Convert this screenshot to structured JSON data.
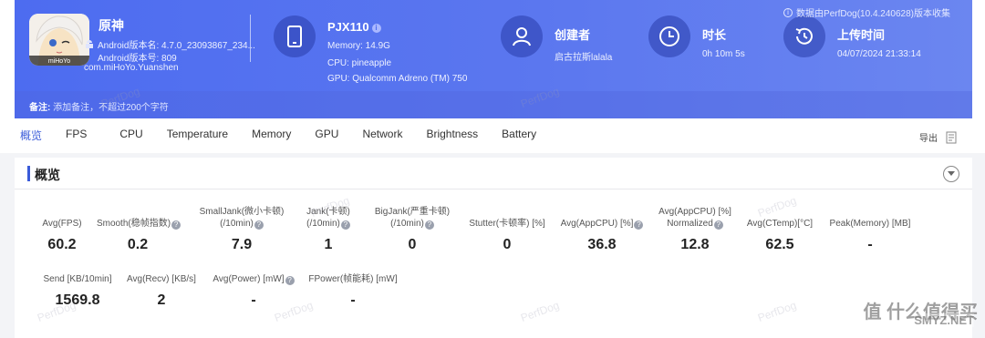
{
  "header": {
    "app_name": "原神",
    "android_version": "Android版本名: 4.7.0_23093867_234...",
    "android_code": "Android版本号: 809",
    "package": "com.miHoYo.Yuanshen",
    "app_icon_text": "miHoYo",
    "device": {
      "model": "PJX110",
      "memory": "Memory: 14.9G",
      "cpu": "CPU: pineapple",
      "gpu": "GPU: Qualcomm Adreno (TM) 750"
    },
    "creator": {
      "title": "创建者",
      "value": "启古拉斯lalala"
    },
    "duration": {
      "title": "时长",
      "value": "0h 10m 5s"
    },
    "upload": {
      "title": "上传时间",
      "value": "04/07/2024 21:33:14"
    },
    "data_source": "数据由PerfDog(10.4.240628)版本收集",
    "note_label": "备注:",
    "note_placeholder": "添加备注，不超过200个字符"
  },
  "tabs": [
    "概览",
    "FPS",
    "CPU",
    "Temperature",
    "Memory",
    "GPU",
    "Network",
    "Brightness",
    "Battery"
  ],
  "active_tab": "概览",
  "export_label": "导出",
  "section_title": "概览",
  "metrics_row1": [
    {
      "label1": "",
      "label2": "Avg(FPS)",
      "help": false,
      "value": "60.2"
    },
    {
      "label1": "",
      "label2": "Smooth(稳帧指数)",
      "help": true,
      "value": "0.2"
    },
    {
      "label1": "SmallJank(微小卡顿)",
      "label2": "(/10min)",
      "help": true,
      "value": "7.9"
    },
    {
      "label1": "Jank(卡顿)",
      "label2": "(/10min)",
      "help": true,
      "value": "1"
    },
    {
      "label1": "BigJank(严重卡顿)",
      "label2": "(/10min)",
      "help": true,
      "value": "0"
    },
    {
      "label1": "",
      "label2": "Stutter(卡顿率) [%]",
      "help": false,
      "value": "0"
    },
    {
      "label1": "",
      "label2": "Avg(AppCPU) [%]",
      "help": true,
      "value": "36.8"
    },
    {
      "label1": "Avg(AppCPU) [%]",
      "label2": "Normalized",
      "help": true,
      "value": "12.8"
    },
    {
      "label1": "",
      "label2": "Avg(CTemp)[°C]",
      "help": false,
      "value": "62.5"
    },
    {
      "label1": "",
      "label2": "Peak(Memory) [MB]",
      "help": false,
      "value": "-"
    }
  ],
  "metrics_row2": [
    {
      "label": "Send [KB/10min]",
      "help": false,
      "value": "1569.8"
    },
    {
      "label": "Avg(Recv) [KB/s]",
      "help": false,
      "value": "2"
    },
    {
      "label": "Avg(Power) [mW]",
      "help": true,
      "value": "-"
    },
    {
      "label": "FPower(帧能耗) [mW]",
      "help": false,
      "value": "-"
    }
  ],
  "watermark": "PerfDog",
  "site_mark": "值 什么值得买",
  "site_sub": "SMYZ.NET"
}
